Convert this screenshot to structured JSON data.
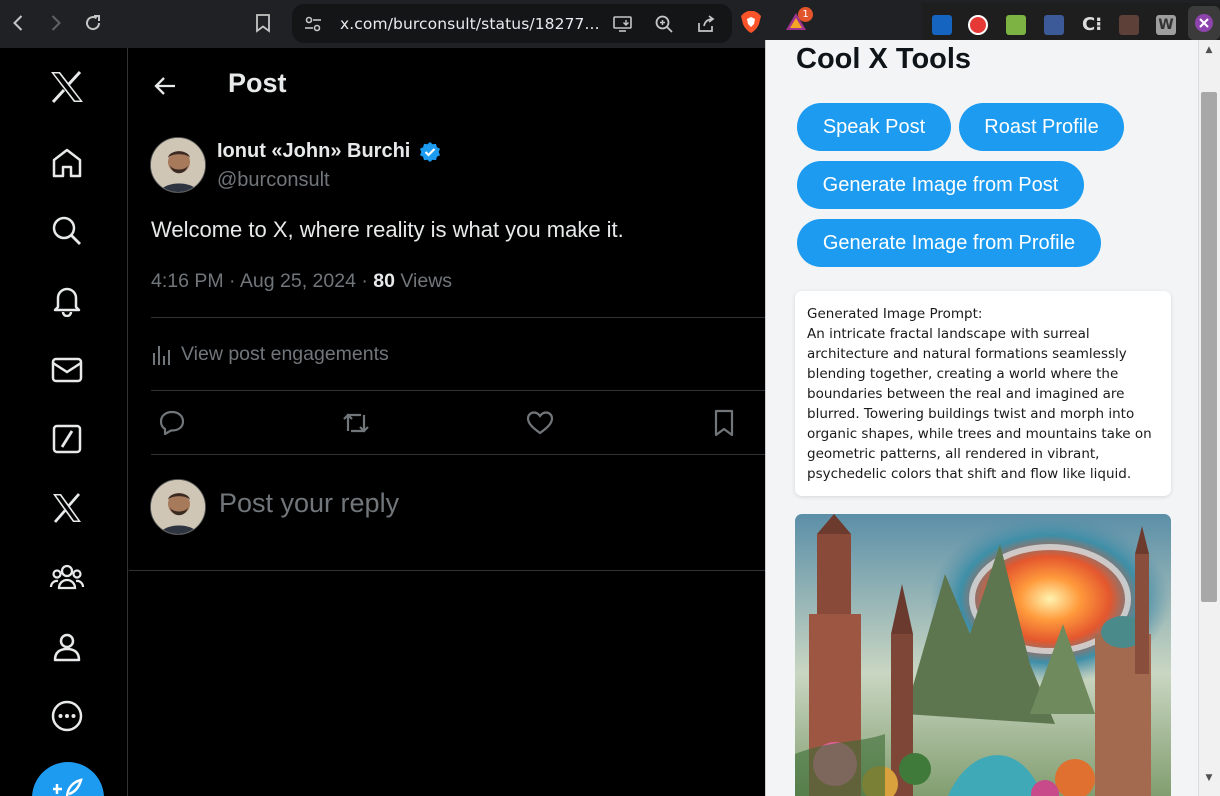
{
  "browser": {
    "url": "x.com/burconsult/status/18277...",
    "brave_badge_count": "1",
    "icons": [
      "back-icon",
      "forward-icon",
      "reload-icon",
      "bookmark-icon",
      "site-info-icon",
      "install-app-icon",
      "zoom-icon",
      "share-icon",
      "brave-shields-icon",
      "brave-rewards-icon"
    ]
  },
  "sidebar": {
    "items": [
      "x-logo",
      "home",
      "explore",
      "notifications",
      "messages",
      "grok",
      "premium",
      "communities",
      "profile",
      "more"
    ],
    "post_button_icon": "compose-icon"
  },
  "post": {
    "header_title": "Post",
    "author_name": "Ionut «John» Burchi",
    "author_handle": "@burconsult",
    "text": "Welcome to X, where reality is what you make it.",
    "time": "4:16 PM",
    "date": "Aug 25, 2024",
    "views_count": "80",
    "views_label": "Views",
    "engagements_label": "View post engagements",
    "reply_placeholder": "Post your reply"
  },
  "panel": {
    "title": "Cool X Tools",
    "buttons": {
      "speak_post": "Speak Post",
      "roast_profile": "Roast Profile",
      "image_from_post": "Generate Image from Post",
      "image_from_profile": "Generate Image from Profile"
    },
    "prompt_label": "Generated Image Prompt:",
    "prompt_text": "An intricate fractal landscape with surreal architecture and natural formations seamlessly blending together, creating a world where the boundaries between the real and imagined are blurred. Towering buildings twist and morph into organic shapes, while trees and mountains take on geometric patterns, all rendered in vibrant, psychedelic colors that shift and flow like liquid."
  },
  "colors": {
    "accent": "#1d9bf0",
    "background": "#000000",
    "panel_background": "#f2f4f6",
    "muted_text": "#71767b"
  }
}
